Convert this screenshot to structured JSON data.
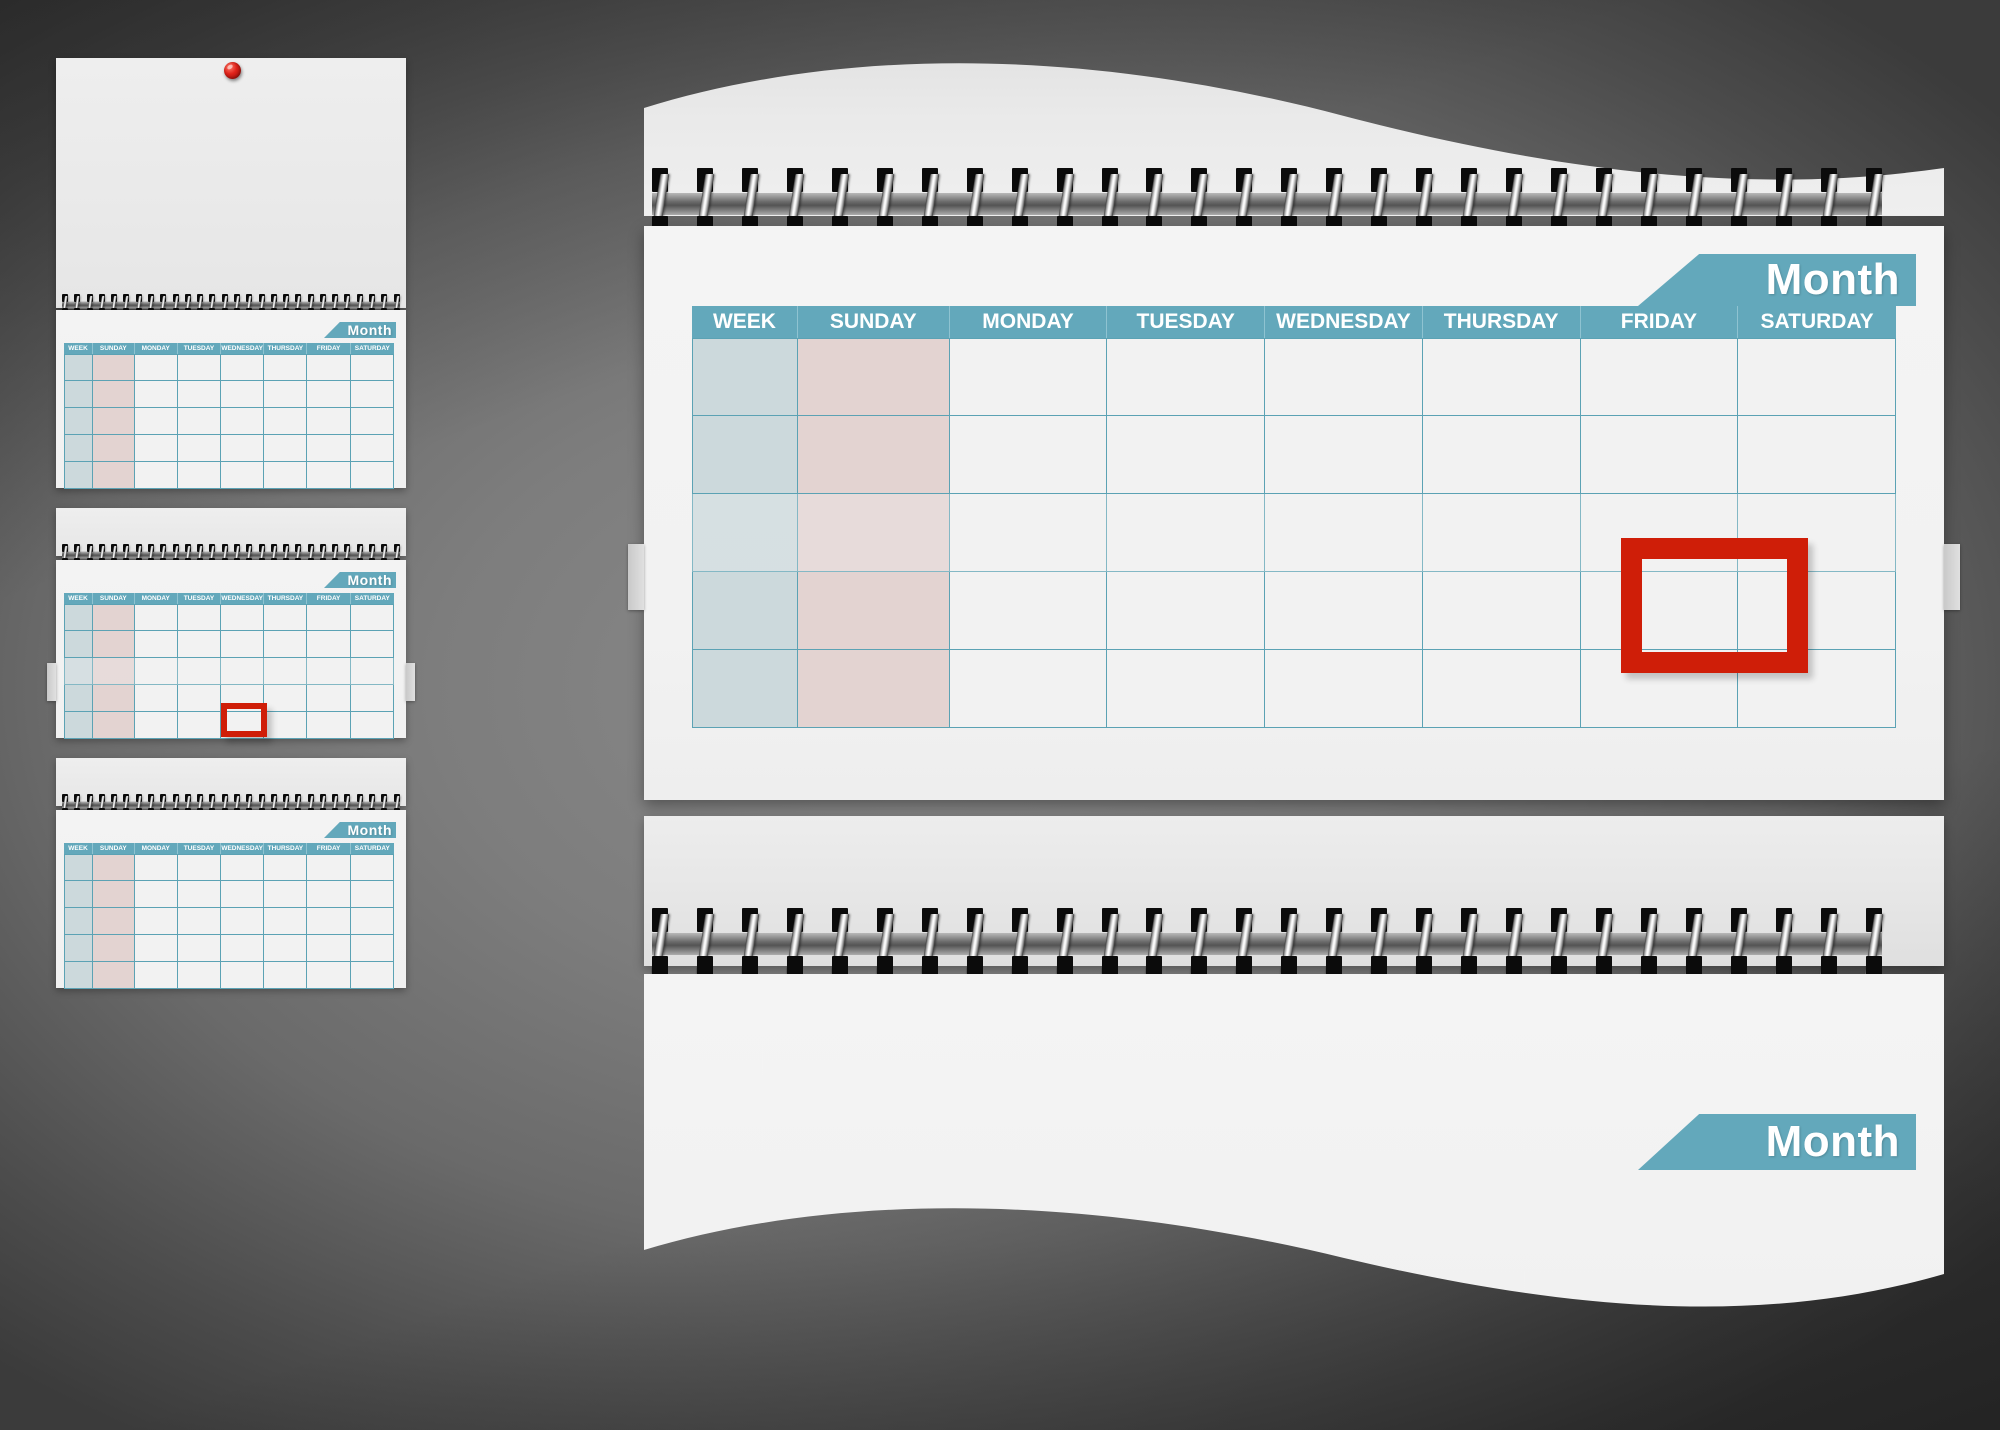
{
  "scene": {
    "title": "Wall Calendar Mockup",
    "background_color": "#6e6e6e"
  },
  "theme": {
    "accent_teal": "#63a8bb",
    "grid_line": "#5ba2b4",
    "week_column_fill": "#ccd9dc",
    "sunday_column_fill": "#e3d3d1",
    "cell_fill": "#f2f2f2",
    "paper": "#f2f2f2",
    "highlight_red": "#cf1e08",
    "pin_red": "#e0231a"
  },
  "main_calendar": {
    "month_label": "Month",
    "bottom_month_label": "Month",
    "columns": [
      "WEEK",
      "SUNDAY",
      "MONDAY",
      "TUESDAY",
      "WEDNESDAY",
      "THURSDAY",
      "FRIDAY",
      "SATURDAY"
    ],
    "rows": 5,
    "row_labels": [
      "",
      "",
      "",
      "",
      ""
    ],
    "highlight": {
      "day_column": "WEDNESDAY",
      "row_index": 3,
      "color": "#cf1e08",
      "shape": "rectangle-outline"
    },
    "binding": {
      "type": "spiral-wire",
      "top_rings": 28,
      "bottom_rings": 28
    },
    "page_edge": "wavy"
  },
  "mini_calendars": [
    {
      "id": "mini-1",
      "month_label": "Month",
      "columns": [
        "WEEK",
        "SUNDAY",
        "MONDAY",
        "TUESDAY",
        "WEDNESDAY",
        "THURSDAY",
        "FRIDAY",
        "SATURDAY"
      ],
      "rows": 5,
      "has_pushpin": true,
      "has_highlight": false
    },
    {
      "id": "mini-2",
      "month_label": "Month",
      "columns": [
        "WEEK",
        "SUNDAY",
        "MONDAY",
        "TUESDAY",
        "WEDNESDAY",
        "THURSDAY",
        "FRIDAY",
        "SATURDAY"
      ],
      "rows": 5,
      "has_pushpin": false,
      "has_highlight": true,
      "highlight": {
        "day_column": "WEDNESDAY",
        "row_index": 3,
        "color": "#cf1e08"
      }
    },
    {
      "id": "mini-3",
      "month_label": "Month",
      "columns": [
        "WEEK",
        "SUNDAY",
        "MONDAY",
        "TUESDAY",
        "WEDNESDAY",
        "THURSDAY",
        "FRIDAY",
        "SATURDAY"
      ],
      "rows": 5,
      "has_pushpin": false,
      "has_highlight": false
    }
  ]
}
